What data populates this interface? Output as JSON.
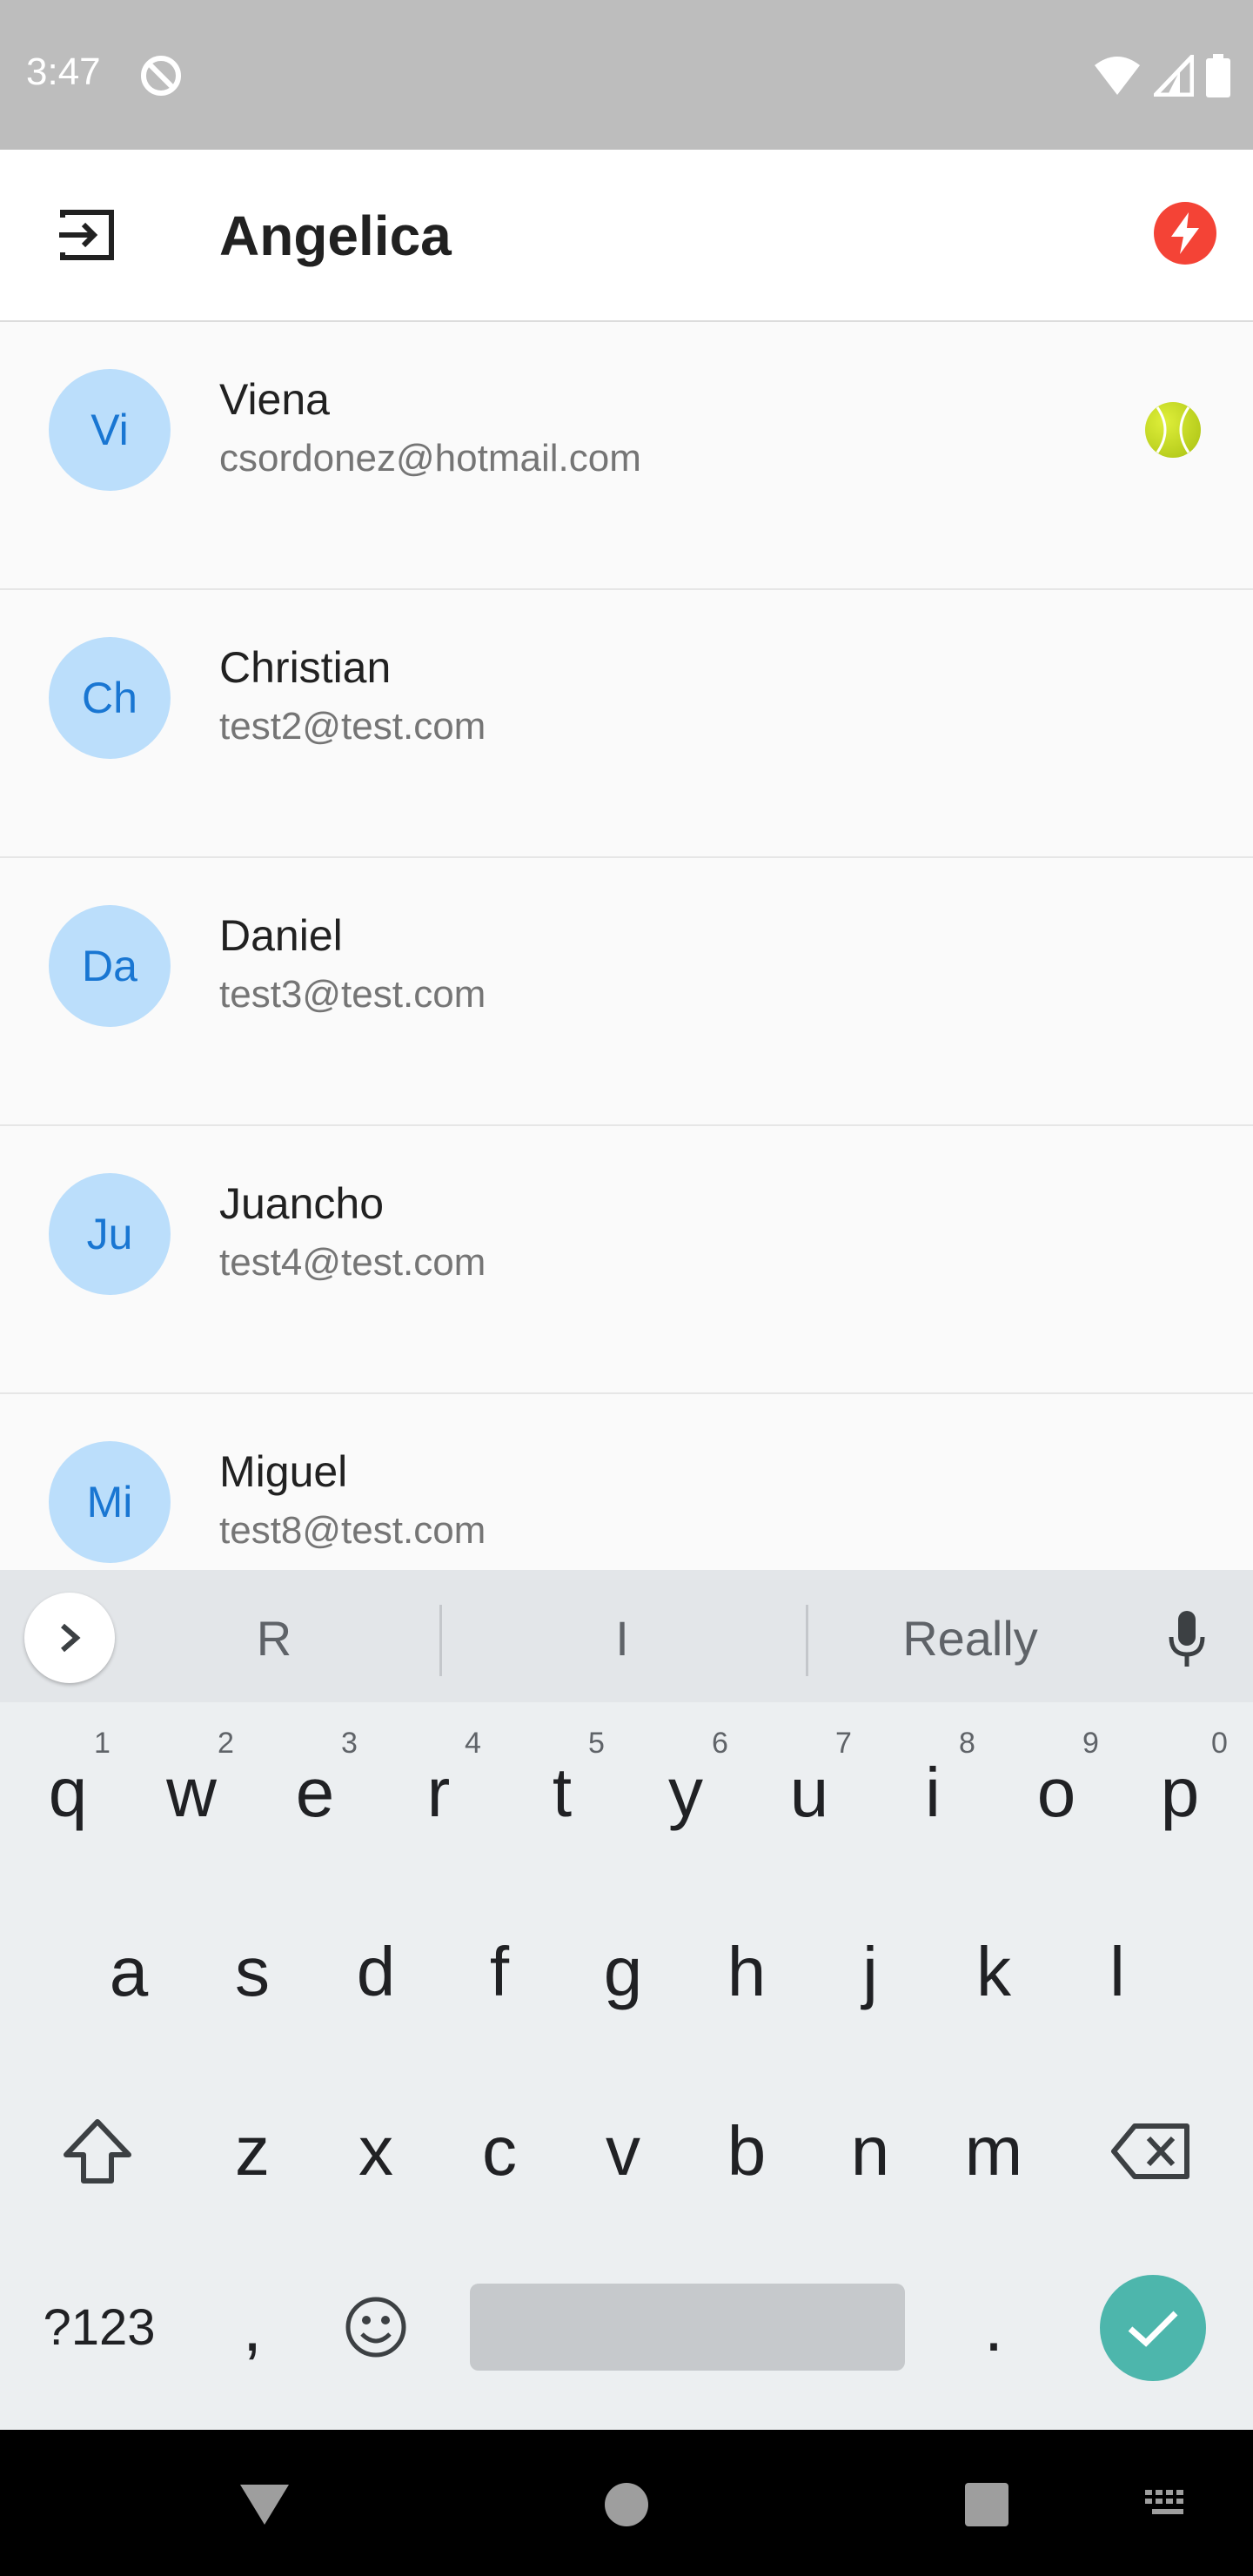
{
  "status_bar": {
    "time": "3:47"
  },
  "app_bar": {
    "title": "Angelica"
  },
  "contacts": [
    {
      "initials": "Vi",
      "name": "Viena",
      "email": "csordonez@hotmail.com",
      "badge": "tennis-ball"
    },
    {
      "initials": "Ch",
      "name": "Christian",
      "email": "test2@test.com"
    },
    {
      "initials": "Da",
      "name": "Daniel",
      "email": "test3@test.com"
    },
    {
      "initials": "Ju",
      "name": "Juancho",
      "email": "test4@test.com"
    },
    {
      "initials": "Mi",
      "name": "Miguel",
      "email": "test8@test.com"
    }
  ],
  "keyboard": {
    "suggestions": [
      "R",
      "I",
      "Really"
    ],
    "row1": [
      "q",
      "w",
      "e",
      "r",
      "t",
      "y",
      "u",
      "i",
      "o",
      "p"
    ],
    "row1_hints": [
      "1",
      "2",
      "3",
      "4",
      "5",
      "6",
      "7",
      "8",
      "9",
      "0"
    ],
    "row2": [
      "a",
      "s",
      "d",
      "f",
      "g",
      "h",
      "j",
      "k",
      "l"
    ],
    "row3": [
      "z",
      "x",
      "c",
      "v",
      "b",
      "n",
      "m"
    ],
    "symbols_label": "?123",
    "comma": ",",
    "period": "."
  },
  "colors": {
    "accent": "#f44336",
    "avatar_bg": "#bbdefb",
    "avatar_text": "#1976d2",
    "enter_key": "#4db6ac"
  }
}
